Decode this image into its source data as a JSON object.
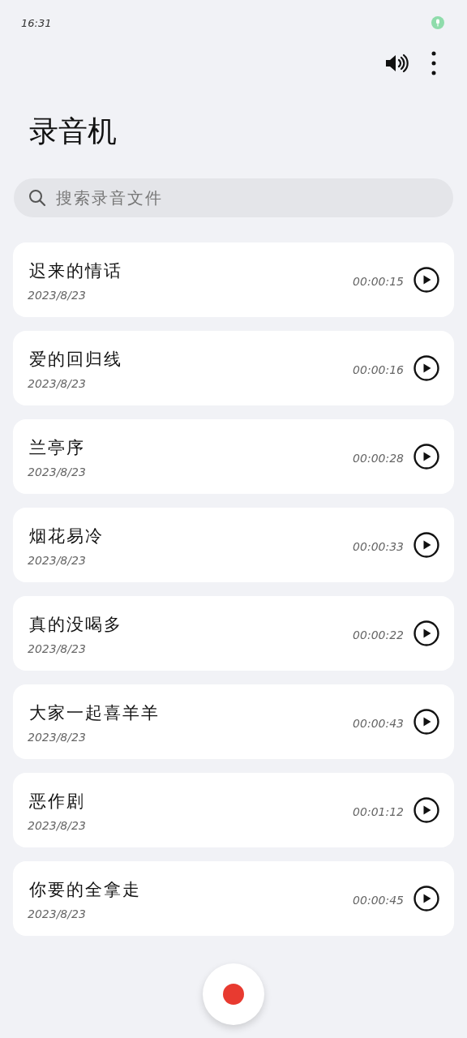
{
  "status_bar": {
    "time": "16:31"
  },
  "title": "录音机",
  "search": {
    "placeholder": "搜索录音文件"
  },
  "recordings": [
    {
      "name": "迟来的情话",
      "date": "2023/8/23",
      "duration": "00:00:15"
    },
    {
      "name": "爱的回归线",
      "date": "2023/8/23",
      "duration": "00:00:16"
    },
    {
      "name": "兰亭序",
      "date": "2023/8/23",
      "duration": "00:00:28"
    },
    {
      "name": "烟花易冷",
      "date": "2023/8/23",
      "duration": "00:00:33"
    },
    {
      "name": "真的没喝多",
      "date": "2023/8/23",
      "duration": "00:00:22"
    },
    {
      "name": "大家一起喜羊羊",
      "date": "2023/8/23",
      "duration": "00:00:43"
    },
    {
      "name": "恶作剧",
      "date": "2023/8/23",
      "duration": "00:01:12"
    },
    {
      "name": "你要的全拿走",
      "date": "2023/8/23",
      "duration": "00:00:45"
    }
  ]
}
